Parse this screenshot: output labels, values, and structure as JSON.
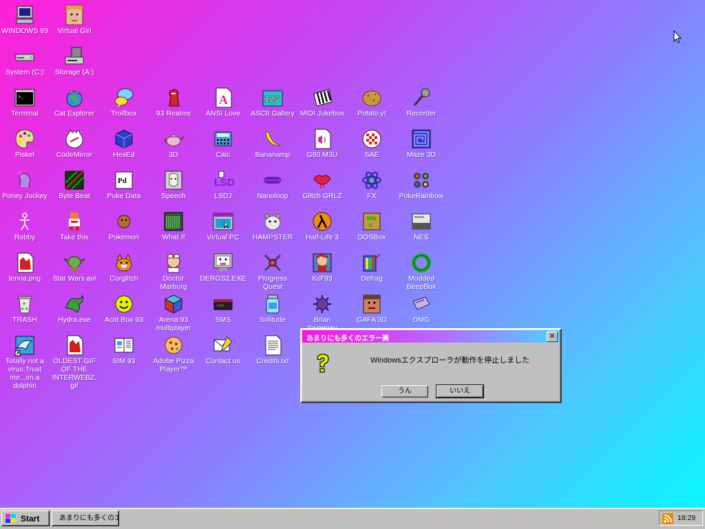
{
  "desktop": {
    "icons": [
      {
        "label": "WINDOWS 93",
        "icon": "computer-icon"
      },
      {
        "label": "Virtual Girl",
        "icon": "face-icon"
      },
      {
        "label": "System (C:)",
        "icon": "hard-drive-icon"
      },
      {
        "label": "Storage (A:)",
        "icon": "floppy-drive-icon"
      },
      {
        "label": "Terminal",
        "icon": "terminal-icon"
      },
      {
        "label": "Cat Explorer",
        "icon": "cat-globe-icon"
      },
      {
        "label": "Trollbox",
        "icon": "chat-bubbles-icon"
      },
      {
        "label": "93 Realms",
        "icon": "knight-icon"
      },
      {
        "label": "ANSI Love",
        "icon": "ansi-document-icon"
      },
      {
        "label": "ASCII Gallery",
        "icon": "ascii-gallery-icon"
      },
      {
        "label": "MIDI Jukebox",
        "icon": "piano-keys-icon"
      },
      {
        "label": "Potato.yt",
        "icon": "potato-icon"
      },
      {
        "label": "Recorder",
        "icon": "microphone-icon"
      },
      {
        "label": "Piskel",
        "icon": "palette-icon"
      },
      {
        "label": "CodeMirror",
        "icon": "cat-code-icon"
      },
      {
        "label": "HexEd",
        "icon": "hex-cube-icon"
      },
      {
        "label": "3D",
        "icon": "teapot-icon"
      },
      {
        "label": "Calc",
        "icon": "calculator-icon"
      },
      {
        "label": "Bananamp",
        "icon": "banana-icon"
      },
      {
        "label": "G80.M3U",
        "icon": "playlist-icon"
      },
      {
        "label": "SAE",
        "icon": "checkered-ball-icon"
      },
      {
        "label": "Maze 3D",
        "icon": "maze-icon"
      },
      {
        "label": "Poney Jockey",
        "icon": "pony-icon"
      },
      {
        "label": "Byte Beat",
        "icon": "bytebeat-icon"
      },
      {
        "label": "Puke Data",
        "icon": "puke-data-icon"
      },
      {
        "label": "Speech",
        "icon": "speech-face-icon"
      },
      {
        "label": "LSDJ",
        "icon": "lsdj-icon"
      },
      {
        "label": "Nanoloop",
        "icon": "nanoloop-icon"
      },
      {
        "label": "Glitch GRLZ",
        "icon": "lips-icon"
      },
      {
        "label": "FX",
        "icon": "atom-icon"
      },
      {
        "label": "PokeRainbow",
        "icon": "pokerainbow-icon"
      },
      {
        "label": "Robby",
        "icon": "stick-figure-icon"
      },
      {
        "label": "Take this",
        "icon": "pixel-man-icon"
      },
      {
        "label": "Pokemon",
        "icon": "poke-icon"
      },
      {
        "label": "What If",
        "icon": "what-if-icon"
      },
      {
        "label": "Virtual PC",
        "icon": "virtual-pc-icon"
      },
      {
        "label": "HAMPSTER",
        "icon": "hamster-icon"
      },
      {
        "label": "Half-Life 3",
        "icon": "lambda-icon"
      },
      {
        "label": "DOSBox",
        "icon": "dosbox-icon"
      },
      {
        "label": "NES",
        "icon": "nes-icon"
      },
      {
        "label": "lenna.png",
        "icon": "image-file-icon"
      },
      {
        "label": "Star Wars.avi",
        "icon": "yoda-icon"
      },
      {
        "label": "Corglitch",
        "icon": "corgi-icon"
      },
      {
        "label": "Doctor Marburg",
        "icon": "doctor-icon"
      },
      {
        "label": "DERGS2.EXE",
        "icon": "monitor-face-icon"
      },
      {
        "label": "Progress Quest",
        "icon": "crossed-swords-icon"
      },
      {
        "label": "Kof'93",
        "icon": "fighter-icon"
      },
      {
        "label": "Defrag",
        "icon": "defrag-icon"
      },
      {
        "label": "Modded BeepBox",
        "icon": "green-ring-icon"
      },
      {
        "label": "TRASH",
        "icon": "recycle-bin-icon"
      },
      {
        "label": "Hydra.exe",
        "icon": "dragon-icon"
      },
      {
        "label": "Acid Box 93",
        "icon": "smiley-icon"
      },
      {
        "label": "Arena 93 multiplayer",
        "icon": "cube-icon"
      },
      {
        "label": "SMS",
        "icon": "console-icon"
      },
      {
        "label": "Solitude",
        "icon": "jar-icon"
      },
      {
        "label": "Brian Sweeney",
        "icon": "spiky-ball-icon"
      },
      {
        "label": "GAFA 3D",
        "icon": "doom-face-icon"
      },
      {
        "label": "DMG",
        "icon": "cartridge-icon"
      },
      {
        "label": "Totally not a virus.Trust me...im a dolphin",
        "icon": "dolphin-icon"
      },
      {
        "label": "OLDEST GIF OF THE INTERWEBZ.gif",
        "icon": "gif-file-icon"
      },
      {
        "label": "SIM 93",
        "icon": "book-icon"
      },
      {
        "label": "Adobe Pizza Player™",
        "icon": "pizza-icon"
      },
      {
        "label": "Contact us",
        "icon": "contact-letter-icon"
      },
      {
        "label": "Credits.txt",
        "icon": "text-file-icon"
      }
    ]
  },
  "dialog": {
    "title": "あまりにも多くのエラー美",
    "message": "Windowsエクスプローラが動作を停止しました",
    "yes_label": "うん",
    "no_label": "いいえ",
    "close_glyph": "✕",
    "icon": "question-mark-icon"
  },
  "taskbar": {
    "start_label": "Start",
    "task_label": "あまりにも多くのエ...",
    "clock": "18:29"
  },
  "colors": {
    "gradient_start": "#ff1fd8",
    "gradient_end": "#00fbff",
    "window_face": "#c0c0c0"
  }
}
